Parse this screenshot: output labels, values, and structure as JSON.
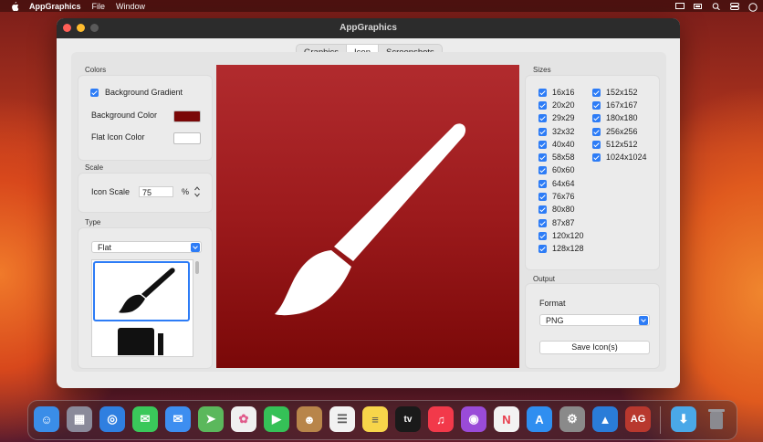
{
  "menubar": {
    "app_name": "AppGraphics",
    "items": [
      "File",
      "Window"
    ]
  },
  "window": {
    "title": "AppGraphics",
    "tabs": [
      {
        "label": "Graphics",
        "active": false
      },
      {
        "label": "Icon",
        "active": true
      },
      {
        "label": "Screenshots",
        "active": false
      }
    ]
  },
  "colors": {
    "section_label": "Colors",
    "background_gradient_label": "Background Gradient",
    "background_gradient_checked": true,
    "background_color_label": "Background Color",
    "background_color_value": "#7a0808",
    "flat_icon_color_label": "Flat Icon Color",
    "flat_icon_color_value": "#ffffff"
  },
  "scale": {
    "section_label": "Scale",
    "icon_scale_label": "Icon Scale",
    "icon_scale_value": "75",
    "unit": "%"
  },
  "type": {
    "section_label": "Type",
    "selected": "Flat"
  },
  "sizes": {
    "section_label": "Sizes",
    "column1": [
      "16x16",
      "20x20",
      "29x29",
      "32x32",
      "40x40",
      "58x58",
      "60x60",
      "64x64",
      "76x76",
      "80x80",
      "87x87",
      "120x120",
      "128x128"
    ],
    "column2": [
      "152x152",
      "167x167",
      "180x180",
      "256x256",
      "512x512",
      "1024x1024"
    ]
  },
  "output": {
    "section_label": "Output",
    "format_label": "Format",
    "format_value": "PNG",
    "save_button": "Save Icon(s)"
  },
  "dock": {
    "apps": [
      {
        "name": "finder-icon",
        "color": "#3a8de8",
        "glyph": "☺"
      },
      {
        "name": "launchpad-icon",
        "color": "#8a8a9a",
        "glyph": "▦"
      },
      {
        "name": "safari-icon",
        "color": "#2f7fe0",
        "glyph": "◎"
      },
      {
        "name": "messages-icon",
        "color": "#3ac85a",
        "glyph": "💬"
      },
      {
        "name": "mail-icon",
        "color": "#3d8ef0",
        "glyph": "✉"
      },
      {
        "name": "maps-icon",
        "color": "#5bb85c",
        "glyph": "➤"
      },
      {
        "name": "photos-icon",
        "color": "#f0f0f0",
        "glyph": "✿"
      },
      {
        "name": "facetime-icon",
        "color": "#35c157",
        "glyph": "▶"
      },
      {
        "name": "contacts-icon",
        "color": "#b8854a",
        "glyph": "☻"
      },
      {
        "name": "reminders-icon",
        "color": "#f2f2f2",
        "glyph": "☰"
      },
      {
        "name": "notes-icon",
        "color": "#f7d54a",
        "glyph": "≡"
      },
      {
        "name": "tv-icon",
        "color": "#1a1a1a",
        "glyph": "tv"
      },
      {
        "name": "music-icon",
        "color": "#f2394a",
        "glyph": "♫"
      },
      {
        "name": "podcasts-icon",
        "color": "#9a4bd8",
        "glyph": "◉"
      },
      {
        "name": "news-icon",
        "color": "#f2f2f2",
        "glyph": "N"
      },
      {
        "name": "app-store-icon",
        "color": "#2f8ef0",
        "glyph": "A"
      },
      {
        "name": "system-preferences-icon",
        "color": "#8a8a8a",
        "glyph": "⚙"
      },
      {
        "name": "vectornator-icon",
        "color": "#2a7cd8",
        "glyph": "▲"
      },
      {
        "name": "appgraphics-icon",
        "color": "#b8382e",
        "glyph": "AG"
      },
      {
        "name": "downloads-icon",
        "color": "#4aa8e8",
        "glyph": "⬇"
      },
      {
        "name": "trash-icon",
        "color": "#7a7a80",
        "glyph": "🗑"
      }
    ]
  }
}
